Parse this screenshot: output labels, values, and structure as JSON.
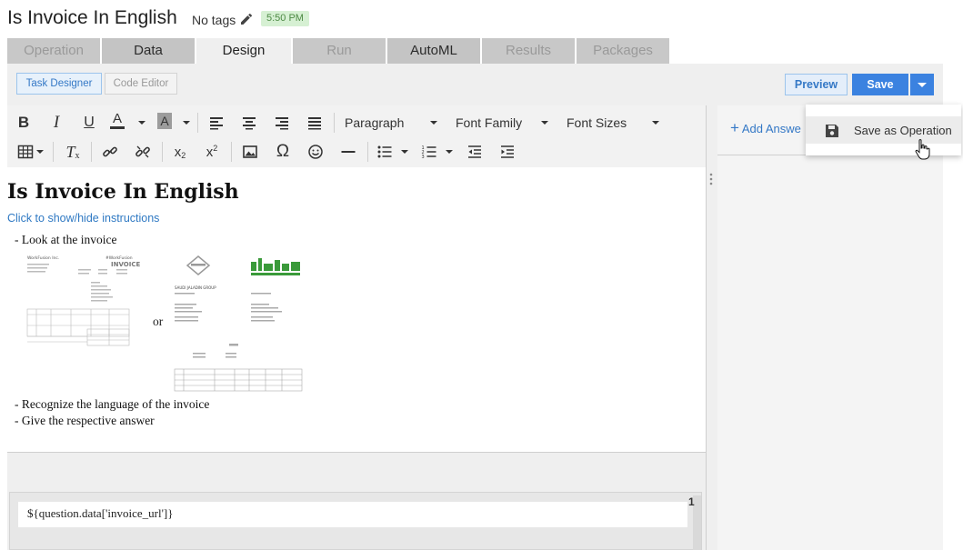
{
  "header": {
    "title": "Is Invoice In English",
    "tags_label": "No tags",
    "time_badge": "5:50 PM"
  },
  "tabs": [
    {
      "label": "Operation",
      "state": "disabled"
    },
    {
      "label": "Data",
      "state": "enabled"
    },
    {
      "label": "Design",
      "state": "active"
    },
    {
      "label": "Run",
      "state": "disabled"
    },
    {
      "label": "AutoML",
      "state": "enabled"
    },
    {
      "label": "Results",
      "state": "disabled"
    },
    {
      "label": "Packages",
      "state": "disabled"
    }
  ],
  "mode_toggle": {
    "task_designer": "Task Designer",
    "code_editor": "Code Editor",
    "active": "Task Designer"
  },
  "actions": {
    "preview": "Preview",
    "save": "Save"
  },
  "save_menu": {
    "items": [
      {
        "label": "Save as Operation",
        "icon": "floppy-disk-icon"
      }
    ]
  },
  "toolbar": {
    "paragraph": "Paragraph",
    "font_family": "Font Family",
    "font_sizes": "Font Sizes",
    "row1_icons": [
      "bold-icon",
      "italic-icon",
      "underline-icon",
      "text-color-icon",
      "background-color-icon",
      "align-left-icon",
      "align-center-icon",
      "align-right-icon",
      "align-justify-icon"
    ],
    "row2_icons": [
      "table-icon",
      "clear-formatting-icon",
      "link-icon",
      "unlink-icon",
      "subscript-icon",
      "superscript-icon",
      "image-icon",
      "special-character-icon",
      "emoji-icon",
      "horizontal-line-icon",
      "bullet-list-icon",
      "numbered-list-icon",
      "outdent-icon",
      "indent-icon"
    ]
  },
  "content": {
    "heading": "Is Invoice In English",
    "instructions_link": "Click to show/hide instructions",
    "line1": "- Look at the invoice",
    "or": "or",
    "line2": "- Recognize the language of the invoice",
    "line3": "- Give the respective answer"
  },
  "template": {
    "expression": "${question.data['invoice_url']}",
    "index": "1"
  },
  "right_panel": {
    "add_answer": "Add Answe"
  },
  "invoice_sample_a": {
    "company": "WorkFusion Inc.",
    "brand": "#WorkFusion",
    "heading": "INVOICE"
  },
  "invoice_sample_b": {
    "company": "SAUDI JALADIN GROUP"
  },
  "colors": {
    "accent": "#3b82e0",
    "link": "#2f79c3",
    "badge_bg": "#d6f0d3",
    "badge_text": "#4e8a45"
  }
}
